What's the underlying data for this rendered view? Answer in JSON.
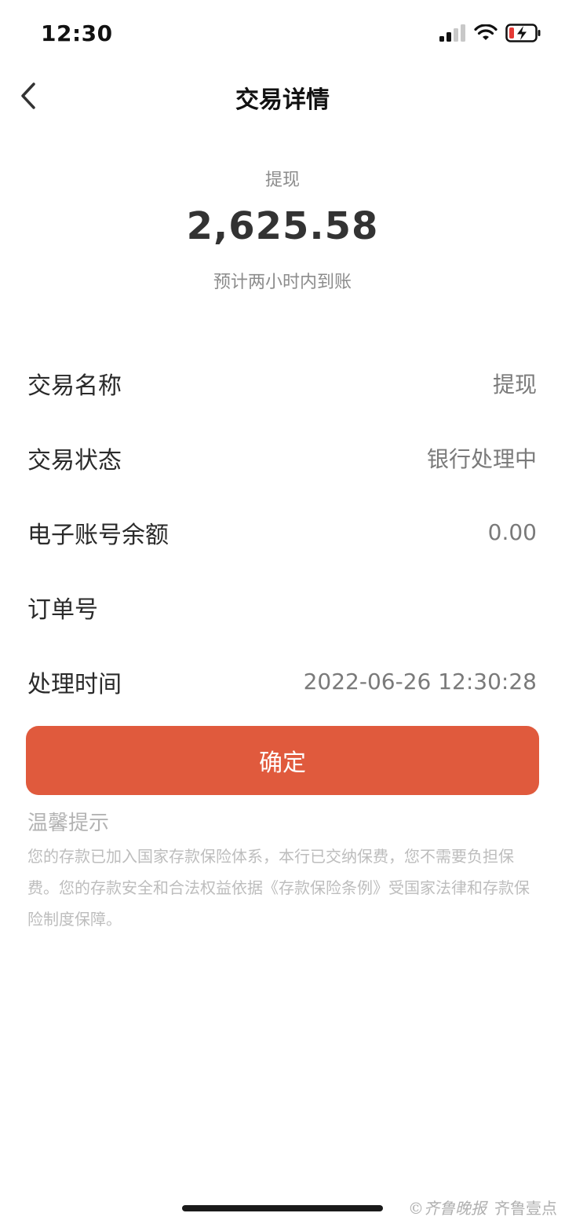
{
  "status_bar": {
    "time": "12:30",
    "icons": [
      "signal-icon",
      "wifi-icon",
      "battery-charging-icon"
    ],
    "battery_color": "#e53935"
  },
  "nav": {
    "back_icon": "chevron-left-icon",
    "title": "交易详情"
  },
  "summary": {
    "type": "提现",
    "amount": "2,625.58",
    "eta": "预计两小时内到账"
  },
  "details": [
    {
      "label": "交易名称",
      "value": "提现"
    },
    {
      "label": "交易状态",
      "value": "银行处理中"
    },
    {
      "label": "电子账号余额",
      "value": "0.00"
    },
    {
      "label": "订单号",
      "value": ""
    },
    {
      "label": "处理时间",
      "value": "2022-06-26 12:30:28"
    }
  ],
  "confirm_button": {
    "label": "确定",
    "color": "#e05a3d"
  },
  "tips": {
    "title": "温馨提示",
    "body": "您的存款已加入国家存款保险体系，本行已交纳保费，您不需要负担保费。您的存款安全和合法权益依据《存款保险条例》受国家法律和存款保险制度保障。"
  },
  "watermark": {
    "left": "©齐鲁晚报",
    "right": "齐鲁壹点"
  }
}
